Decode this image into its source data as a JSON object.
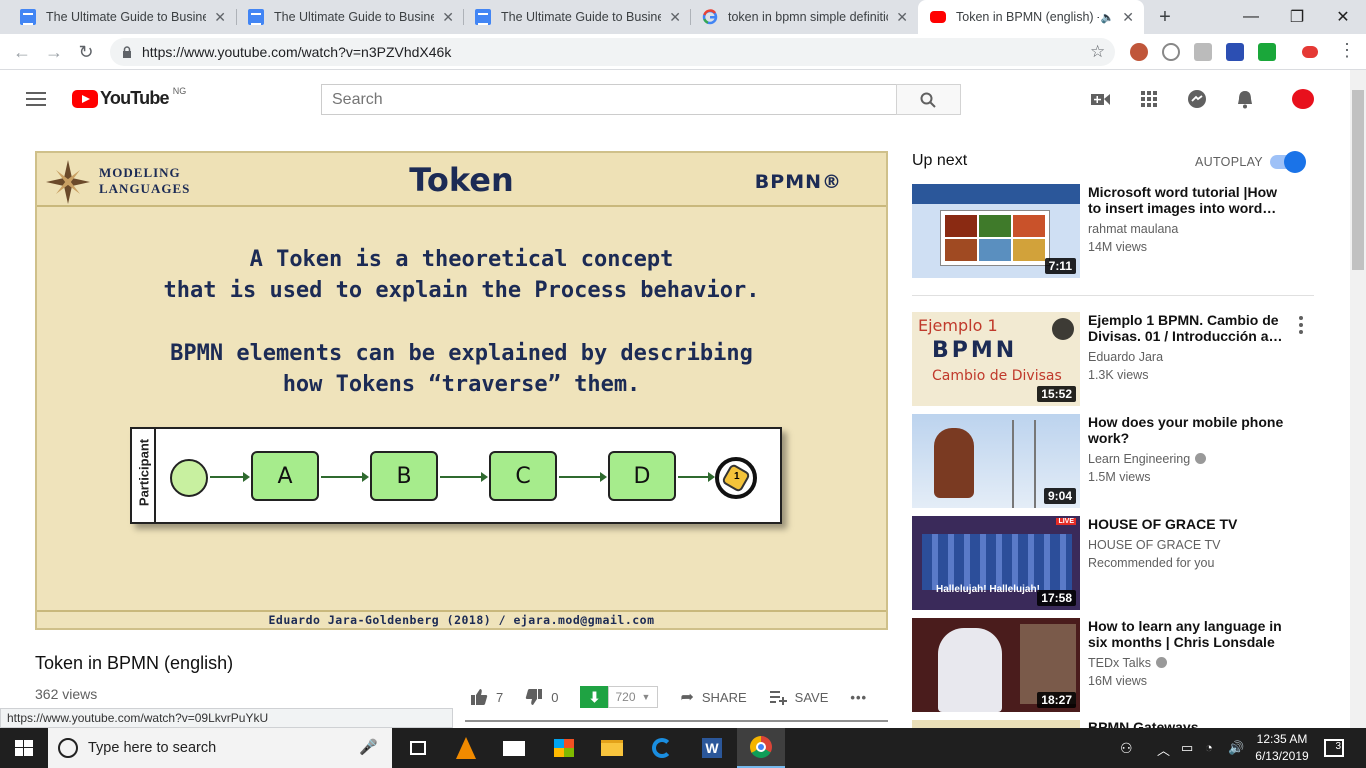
{
  "browser": {
    "tabs": [
      {
        "title": "The Ultimate Guide to Business",
        "type": "doc"
      },
      {
        "title": "The Ultimate Guide to Business",
        "type": "doc"
      },
      {
        "title": "The Ultimate Guide to Business",
        "type": "doc"
      },
      {
        "title": "token in bpmn simple definitio",
        "type": "google"
      },
      {
        "title": "Token in BPMN (english) -",
        "type": "youtube",
        "active": true
      }
    ],
    "new_tab_label": "+",
    "url": "https://www.youtube.com/watch?v=n3PZVhdX46k",
    "status_url": "https://www.youtube.com/watch?v=09LkvrPuYkU"
  },
  "youtube": {
    "logo_text": "YouTube",
    "country_code": "NG",
    "search_placeholder": "Search"
  },
  "slide": {
    "brand_line1": "Modeling",
    "brand_line2": "Languages",
    "title": "Token",
    "badge": "BPMN®",
    "text_line1": "A Token is a theoretical concept",
    "text_line2": "that is used to explain the Process behavior.",
    "text_line3": "BPMN elements can be explained by describing",
    "text_line4": "how Tokens “traverse” them.",
    "lane_label": "Participant",
    "tasks": [
      "A",
      "B",
      "C",
      "D"
    ],
    "token_number": "1",
    "footer": "Eduardo Jara-Goldenberg (2018) / ejara.mod@gmail.com"
  },
  "video": {
    "title": "Token in BPMN (english)",
    "views": "362 views",
    "likes": "7",
    "dislikes": "0",
    "download_quality": "720",
    "share_label": "SHARE",
    "save_label": "SAVE",
    "more_label": "•••"
  },
  "sidebar": {
    "up_next": "Up next",
    "autoplay": "AUTOPLAY",
    "videos": [
      {
        "title": "Microsoft word tutorial |How to insert images into word…",
        "channel": "rahmat maulana",
        "meta": "14M views",
        "duration": "7:11",
        "verified": false
      },
      {
        "title": "Ejemplo 1 BPMN. Cambio de Divisas. 01 / Introducción a…",
        "channel": "Eduardo Jara",
        "meta": "1.3K views",
        "duration": "15:52",
        "verified": false
      },
      {
        "title": "How does your mobile phone work?",
        "channel": "Learn Engineering",
        "meta": "1.5M views",
        "duration": "9:04",
        "verified": true
      },
      {
        "title": "HOUSE OF GRACE TV",
        "channel": "HOUSE OF GRACE TV",
        "meta": "Recommended for you",
        "duration": "17:58",
        "verified": false
      },
      {
        "title": "How to learn any language in six months | Chris Lonsdale |…",
        "channel": "TEDx Talks",
        "meta": "16M views",
        "duration": "18:27",
        "verified": true
      }
    ],
    "partial_next": "BPMN Gateways",
    "thumb2_line1": "Ejemplo 1",
    "thumb2_line2": "BPMN",
    "thumb2_line3": "Cambio de Divisas",
    "thumb4_caption": "Hallelujah! Hallelujah!",
    "live_badge": "LIVE"
  },
  "taskbar": {
    "search_placeholder": "Type here to search",
    "time": "12:35 AM",
    "date": "6/13/2019",
    "notification_count": "3"
  }
}
